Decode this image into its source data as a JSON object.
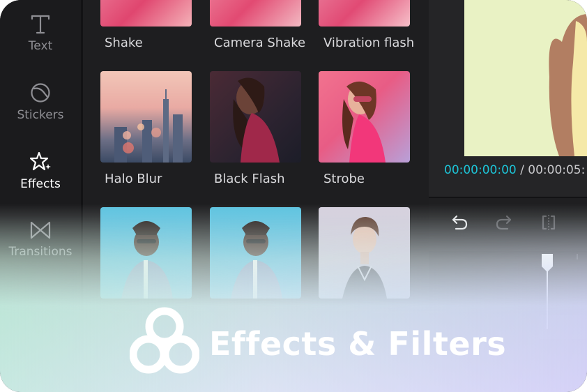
{
  "sidebar": {
    "items": [
      {
        "label": "Text",
        "icon": "text-icon",
        "active": false
      },
      {
        "label": "Stickers",
        "icon": "sticker-icon",
        "active": false
      },
      {
        "label": "Effects",
        "icon": "sparkle-icon",
        "active": true
      },
      {
        "label": "Transitions",
        "icon": "bowtie-icon",
        "active": false
      }
    ]
  },
  "effects": {
    "row0": [
      "Shake",
      "Camera Shake",
      "Vibration flash"
    ],
    "row1": [
      "Halo Blur",
      "Black Flash",
      "Strobe"
    ]
  },
  "player": {
    "current_time": "00:00:00:00",
    "separator": "/",
    "total_time": "00:00:05:"
  },
  "banner": {
    "title": "Effects & Filters"
  },
  "colors": {
    "accent": "#1dc5d8",
    "background": "#1c1c1e",
    "preview_bg": "#e9f2c4"
  }
}
